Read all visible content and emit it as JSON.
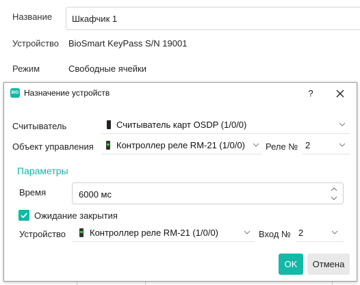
{
  "background_form": {
    "name_label": "Название",
    "name_value": "Шкафчик 1",
    "device_label": "Устройство",
    "device_value": "BioSmart KeyPass S/N 19001",
    "mode_label": "Режим",
    "mode_value": "Свободные ячейки"
  },
  "dialog": {
    "app_icon_text": "BIO",
    "title": "Назначение устройств",
    "help_label": "?",
    "reader": {
      "label": "Считыватель",
      "value": "Считыватель карт OSDP (1/0/0)",
      "icon": "reader-device-icon"
    },
    "control_object": {
      "label": "Объект управления",
      "value": "Контроллер реле RM-21 (1/0/0)",
      "icon": "controller-device-icon"
    },
    "relay": {
      "label": "Реле №",
      "value": "2"
    },
    "parameters": {
      "title": "Параметры",
      "time_label": "Время",
      "time_value": "6000 мс",
      "wait_close_label": "Ожидание закрытия",
      "wait_close_checked": true,
      "device_label": "Устройство",
      "device_value": "Контроллер реле RM-21 (1/0/0)",
      "device_icon": "controller-device-icon",
      "input_label": "Вход №",
      "input_value": "2"
    },
    "ok_label": "OK",
    "cancel_label": "Отмена"
  },
  "colors": {
    "accent": "#14b8a6",
    "cancel_bg": "#e9e9e9",
    "border": "#cfcfcf"
  }
}
